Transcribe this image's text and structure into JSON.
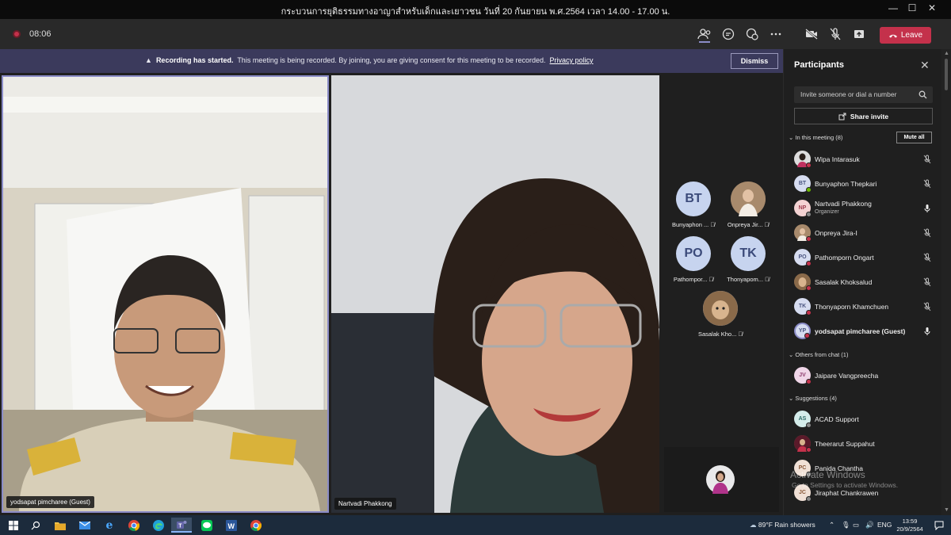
{
  "window": {
    "title": "กระบวนการยุติธรรมทางอาญาสำหรับเด็กและเยาวชน วันที่ 20 กันยายน พ.ศ.2564 เวลา 14.00 - 17.00 น.",
    "minimize": "—",
    "maximize": "☐",
    "close": "✕"
  },
  "toolbar": {
    "timer": "08:06",
    "leave_label": "Leave",
    "icons": [
      "participants-icon",
      "chat-icon",
      "reactions-icon",
      "more-icon",
      "camera-off-icon",
      "mic-off-icon",
      "share-icon"
    ]
  },
  "banner": {
    "bold": "Recording has started.",
    "text": "This meeting is being recorded. By joining, you are giving consent for this meeting to be recorded.",
    "link": "Privacy policy",
    "dismiss": "Dismiss"
  },
  "videos": {
    "left_name": "yodsapat pimcharee (Guest)",
    "right_name": "Nartvadi Phakkong"
  },
  "tiles": [
    {
      "initials": "BT",
      "label": "Bunyaphon ..."
    },
    {
      "initials": "",
      "label": "Onpreya Jir..."
    },
    {
      "initials": "PO",
      "label": "Pathompor..."
    },
    {
      "initials": "TK",
      "label": "Thonyapom..."
    },
    {
      "initials": "",
      "label": "Sasalak Kho..."
    }
  ],
  "participants": {
    "header": "Participants",
    "search_placeholder": "Invite someone or dial a number",
    "share_invite": "Share invite",
    "in_meeting": "In this meeting (8)",
    "mute_all": "Mute all",
    "members": [
      {
        "initials": "",
        "name": "Wipa Intarasuk",
        "role": "",
        "mic": "off"
      },
      {
        "initials": "BT",
        "name": "Bunyaphon Thepkari",
        "role": "",
        "mic": "off"
      },
      {
        "initials": "NP",
        "name": "Nartvadi Phakkong",
        "role": "Organizer",
        "mic": "on"
      },
      {
        "initials": "",
        "name": "Onpreya Jira-I",
        "role": "",
        "mic": "off"
      },
      {
        "initials": "PO",
        "name": "Pathomporn Ongart",
        "role": "",
        "mic": "off"
      },
      {
        "initials": "",
        "name": "Sasalak Khoksalud",
        "role": "",
        "mic": "off"
      },
      {
        "initials": "TK",
        "name": "Thonyaporn Khamchuen",
        "role": "",
        "mic": "off"
      },
      {
        "initials": "YP",
        "name": "yodsapat pimcharee (Guest)",
        "role": "",
        "mic": "on"
      }
    ],
    "others_header": "Others from chat (1)",
    "others": [
      {
        "initials": "JV",
        "name": "Jaipare Vangpreecha"
      }
    ],
    "suggestions_header": "Suggestions (4)",
    "suggestions": [
      {
        "initials": "AS",
        "name": "ACAD Support"
      },
      {
        "initials": "",
        "name": "Theerarut Suppahut"
      },
      {
        "initials": "PC",
        "name": "Panida Chantha"
      },
      {
        "initials": "JC",
        "name": "Jiraphat Chankrawen"
      }
    ]
  },
  "watermark": {
    "line1": "Activate Windows",
    "line2": "Go to Settings to activate Windows."
  },
  "taskbar": {
    "weather": "89°F  Rain showers",
    "lang": "ENG",
    "time": "13:59",
    "date": "20/9/2564"
  },
  "colors": {
    "accent": "#6264a7",
    "leave": "#c4314b",
    "banner": "#3b3a5c",
    "taskbar": "#1c2b3c"
  }
}
